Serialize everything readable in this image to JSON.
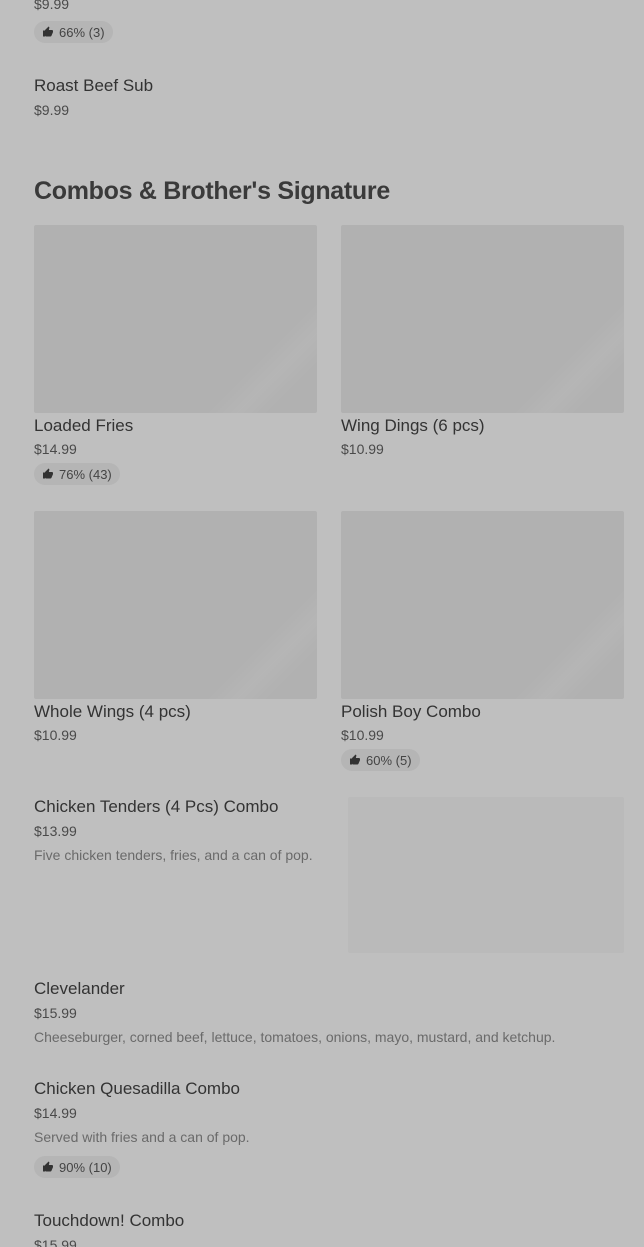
{
  "top_item": {
    "price": "$9.99",
    "rating": "66% (3)"
  },
  "roast_beef": {
    "title": "Roast Beef Sub",
    "price": "$9.99"
  },
  "section": {
    "title": "Combos & Brother's Signature"
  },
  "cards": [
    {
      "title": "Loaded Fries",
      "price": "$14.99",
      "rating": "76% (43)"
    },
    {
      "title": "Wing Dings (6 pcs)",
      "price": "$10.99",
      "rating": ""
    },
    {
      "title": "Whole Wings (4 pcs)",
      "price": "$10.99",
      "rating": ""
    },
    {
      "title": "Polish Boy Combo",
      "price": "$10.99",
      "rating": "60% (5)"
    }
  ],
  "list_items": [
    {
      "title": "Chicken Tenders (4 Pcs) Combo",
      "price": "$13.99",
      "desc": "Five chicken tenders, fries, and a can of pop."
    },
    {
      "title": "Clevelander",
      "price": "$15.99",
      "desc": "Cheeseburger, corned beef, lettuce, tomatoes, onions, mayo, mustard, and ketchup."
    },
    {
      "title": "Chicken Quesadilla Combo",
      "price": "$14.99",
      "desc": "Served with fries and a can of pop.",
      "rating": "90% (10)"
    },
    {
      "title": "Touchdown! Combo",
      "price": "$15.99"
    }
  ],
  "icons": {
    "thumbs_up": "thumbs-up-icon"
  }
}
